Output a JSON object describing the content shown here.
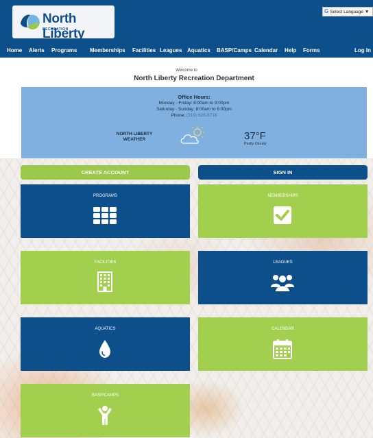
{
  "brand": {
    "name": "North Liberty",
    "subtitle": "RECREATION"
  },
  "language": {
    "label": "Select Language",
    "arrow": "▼"
  },
  "nav": {
    "items": [
      "Home",
      "Alerts",
      "Programs",
      "Memberships",
      "Facilities",
      "Leagues",
      "Aquatics",
      "BASP/Camps",
      "Calendar",
      "Help",
      "Forms"
    ],
    "login": "Log In"
  },
  "welcome": {
    "line": "Welcome to",
    "department": "North Liberty Recreation Department"
  },
  "info": {
    "hours_title": "Office Hours:",
    "weekday": "Monday - Friday: 6:00am to 9:00pm",
    "weekend": "Saturday - Sunday: 8:00am to 6:00pm",
    "phone_label": "Phone: ",
    "phone_number": "(319) 626-5716",
    "weather_location": "NORTH LIBERTY",
    "weather_word": "WEATHER",
    "temperature": "37°F",
    "condition": "Partly Cloudy"
  },
  "buttons": {
    "create_account": "CREATE ACCOUNT",
    "sign_in": "SIGN IN"
  },
  "tiles": [
    {
      "label": "PROGRAMS",
      "icon": "grid-icon",
      "color": "#0d4f8b"
    },
    {
      "label": "MEMBERSHIPS",
      "icon": "checkbox-icon",
      "color": "#a3cf4f"
    },
    {
      "label": "FACILITIES",
      "icon": "building-icon",
      "color": "#a3cf4f"
    },
    {
      "label": "LEAGUES",
      "icon": "group-icon",
      "color": "#0d4f8b"
    },
    {
      "label": "AQUATICS",
      "icon": "water-drop-icon",
      "color": "#0d4f8b"
    },
    {
      "label": "CALENDAR",
      "icon": "calendar-icon",
      "color": "#a3cf4f"
    },
    {
      "label": "BASP/CAMPS",
      "icon": "child-icon",
      "color": "#a3cf4f"
    }
  ],
  "colors": {
    "primary_blue": "#0d4f8b",
    "accent_green": "#a3cf4f",
    "info_panel": "#7fb0e0"
  }
}
